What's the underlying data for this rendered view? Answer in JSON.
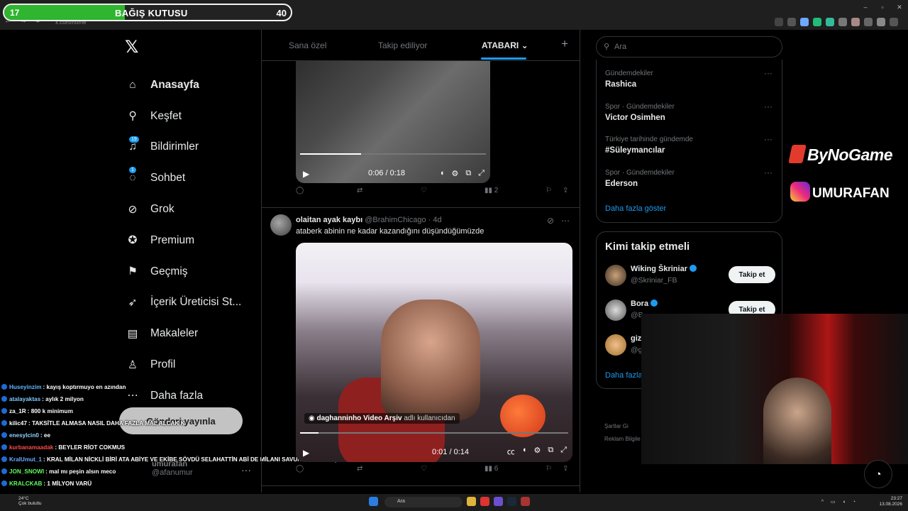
{
  "browser": {
    "url": "x.com/home",
    "window_controls": [
      "–",
      "▫",
      "✕"
    ],
    "nav_controls": [
      "←",
      "→",
      "⟳"
    ]
  },
  "donation": {
    "level": "17",
    "title": "BAĞIŞ KUTUSU",
    "target": "40",
    "progress_fraction": 0.42,
    "fill_color": "#2fb52f"
  },
  "sidebar": {
    "logo": "𝕏",
    "items": [
      {
        "label": "Anasayfa",
        "icon": "home-icon",
        "glyph": "⌂",
        "active": true
      },
      {
        "label": "Keşfet",
        "icon": "search-icon",
        "glyph": "⚲"
      },
      {
        "label": "Bildirimler",
        "icon": "bell-icon",
        "glyph": "♫",
        "badge": "19"
      },
      {
        "label": "Sohbet",
        "icon": "chat-icon",
        "glyph": "◌",
        "badge": "1"
      },
      {
        "label": "Grok",
        "icon": "grok-icon",
        "glyph": "⊘"
      },
      {
        "label": "Premium",
        "icon": "premium-icon",
        "glyph": "✪"
      },
      {
        "label": "Geçmiş",
        "icon": "bookmark-icon",
        "glyph": "⚑"
      },
      {
        "label": "İçerik Üreticisi St...",
        "icon": "rocket-icon",
        "glyph": "➶"
      },
      {
        "label": "Makaleler",
        "icon": "articles-icon",
        "glyph": "▤"
      },
      {
        "label": "Profil",
        "icon": "profile-icon",
        "glyph": "♙"
      },
      {
        "label": "Daha fazla",
        "icon": "more-icon",
        "glyph": "⋯"
      }
    ],
    "post_button": "Gönderi yayınla",
    "profile": {
      "name": "umurafan",
      "handle": "@afanumur",
      "menu": "···"
    }
  },
  "chat": [
    {
      "user": "Huseyinzim",
      "color": "#5fb6ff",
      "text": "kayış koptırmuyo en azından"
    },
    {
      "user": "atalayaktas",
      "color": "#7ec8ff",
      "text": "aylık 2 milyon"
    },
    {
      "user": "za_1R",
      "color": "#ffffff",
      "text": "800 k minimum"
    },
    {
      "user": "kilic47",
      "color": "#ffffff",
      "text": "TAKSİTLE ALMASA NASIL DAHA FAZLA MAL ALCAK K"
    },
    {
      "user": "enesylcin0",
      "color": "#8fd3ff",
      "text": "ee"
    },
    {
      "user": "kurbanamaadak",
      "color": "#ff4b4b",
      "text": "BEYLER RİOT COKMUS"
    },
    {
      "user": "KralUmut_1",
      "color": "#6ea8ff",
      "text": "KRAL MİLAN NİCKLİ BİRİ ATA ABİYE VE EKİBE SÖVDÜ SELAHATTİN ABİ DE MİLANI SAVUNDU KAVGA ÇIKTI"
    },
    {
      "user": "JON_SNOWI",
      "color": "#5cff5c",
      "text": "mal mı peşin alsın meco"
    },
    {
      "user": "KRALCKAB",
      "color": "#5cff5c",
      "text": "1 MİLYON VARÜ"
    }
  ],
  "timeline": {
    "tabs": [
      "Sana özel",
      "Takip ediliyor",
      "ATABARI"
    ],
    "add_tab": "+",
    "post1": {
      "video_time": "0:06 / 0:18",
      "video_progress_fraction": 0.33,
      "views": "2"
    },
    "post2": {
      "author": "olaitan ayak kaybı",
      "handle": "@BrahimChicago",
      "age": "4d",
      "text": "ataberk abinin ne kadar kazandığını düşündüğümüzde",
      "credit_name": "daghanninho Video Arşiv",
      "credit_suffix": "adlı kullanıcıdan",
      "video_time": "0:01 / 0:14",
      "video_progress_fraction": 0.07,
      "views": "6"
    }
  },
  "right": {
    "search_placeholder": "Ara",
    "trends": [
      {
        "context": "Gündemdekiler",
        "title": "Rashica"
      },
      {
        "context": "Spor · Gündemdekiler",
        "title": "Victor Osimhen"
      },
      {
        "context": "Türkiye tarihinde gündemde",
        "title": "#Süleymancılar"
      },
      {
        "context": "Spor · Gündemdekiler",
        "title": "Ederson"
      }
    ],
    "trends_more": "Daha fazla göster",
    "follow_title": "Kimi takip etmeli",
    "suggestions": [
      {
        "name": "Wiking Škriniar",
        "handle": "@Skriniar_FB",
        "button": "Takip et"
      },
      {
        "name": "Bora",
        "handle": "@B",
        "button": "Takip et"
      },
      {
        "name": "giz",
        "handle": "@g",
        "button": ""
      }
    ],
    "follow_more": "Daha fazla",
    "footer_1": "Şartlar   Gi",
    "footer_2": "Reklam Bilgile"
  },
  "branding": {
    "sponsor": "ByNoGame",
    "instagram": "UMURAFAN"
  },
  "taskbar": {
    "weather_temp": "24°C",
    "weather_desc": "Çok bulutlu",
    "search": "Ara",
    "time": "23:27",
    "date": "13.08.2026"
  }
}
